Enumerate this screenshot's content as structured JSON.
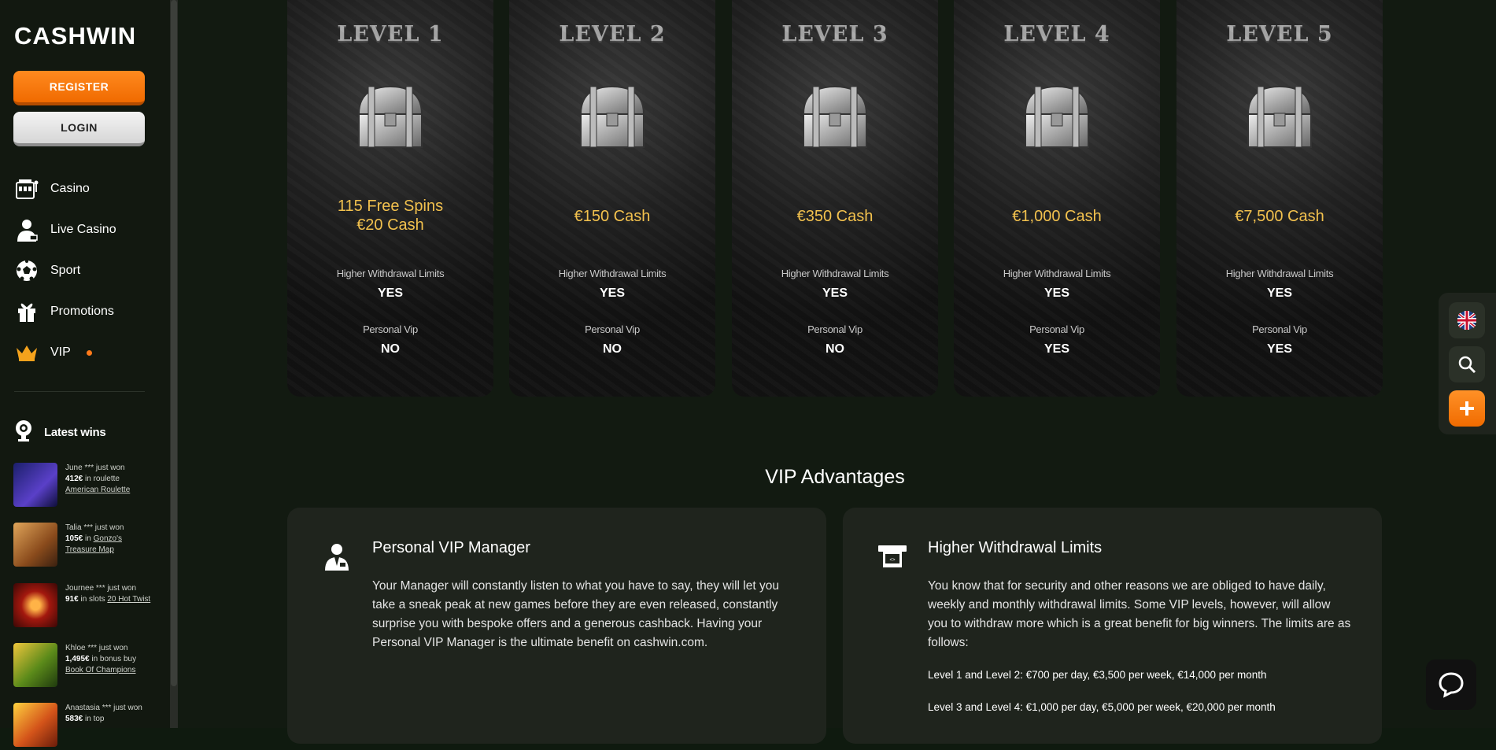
{
  "brand": {
    "logo": "CASHWIN"
  },
  "auth": {
    "register": "REGISTER",
    "login": "LOGIN"
  },
  "nav": [
    {
      "label": "Casino",
      "icon": "slot-machine-icon"
    },
    {
      "label": "Live Casino",
      "icon": "dealer-icon"
    },
    {
      "label": "Sport",
      "icon": "soccer-ball-icon"
    },
    {
      "label": "Promotions",
      "icon": "gift-icon"
    },
    {
      "label": "VIP",
      "icon": "crown-icon"
    }
  ],
  "latest_wins": {
    "title": "Latest wins",
    "items": [
      {
        "user": "June *** just won",
        "amount": "412€",
        "context": "in roulette",
        "game": "American Roulette",
        "thumb_color": "#3a2f8f"
      },
      {
        "user": "Talia *** just won",
        "amount": "105€",
        "context": "in",
        "game": "Gonzo's Treasure Map",
        "thumb_color": "#b3752a"
      },
      {
        "user": "Journee *** just won",
        "amount": "91€",
        "context": "in slots",
        "game": "20 Hot Twist",
        "thumb_color": "#6a1a10"
      },
      {
        "user": "Khloe *** just won",
        "amount": "1,495€",
        "context": "in bonus buy",
        "game": "Book Of Champions",
        "thumb_color": "#3b6d1f"
      },
      {
        "user": "Anastasia *** just won",
        "amount": "583€",
        "context": "in top",
        "game": "",
        "thumb_color": "#c24a18"
      }
    ]
  },
  "levels": [
    {
      "title": "LEVEL 1",
      "reward": "115 Free Spins\n€20 Cash",
      "withdrawal_label": "Higher Withdrawal Limits",
      "withdrawal": "YES",
      "vip_label": "Personal Vip",
      "vip": "NO"
    },
    {
      "title": "LEVEL 2",
      "reward": "€150 Cash",
      "withdrawal_label": "Higher Withdrawal Limits",
      "withdrawal": "YES",
      "vip_label": "Personal Vip",
      "vip": "NO"
    },
    {
      "title": "LEVEL 3",
      "reward": "€350 Cash",
      "withdrawal_label": "Higher Withdrawal Limits",
      "withdrawal": "YES",
      "vip_label": "Personal Vip",
      "vip": "NO"
    },
    {
      "title": "LEVEL 4",
      "reward": "€1,000 Cash",
      "withdrawal_label": "Higher Withdrawal Limits",
      "withdrawal": "YES",
      "vip_label": "Personal Vip",
      "vip": "YES"
    },
    {
      "title": "LEVEL 5",
      "reward": "€7,500 Cash",
      "withdrawal_label": "Higher Withdrawal Limits",
      "withdrawal": "YES",
      "vip_label": "Personal Vip",
      "vip": "YES"
    }
  ],
  "advantages": {
    "title": "VIP Advantages",
    "manager": {
      "title": "Personal VIP Manager",
      "body": "Your Manager will constantly listen to what you have to say, they will let you take a sneak peak at new games before they are even released, constantly surprise you with bespoke offers and a generous cashback. Having your Personal VIP Manager is the ultimate benefit on cashwin.com."
    },
    "withdrawal": {
      "title": "Higher Withdrawal Limits",
      "body": "You know that for security and other reasons we are obliged to have daily, weekly and monthly withdrawal limits. Some VIP levels, however, will allow you to withdraw more which is a great benefit for big winners. The limits are as follows:",
      "line1": "Level 1 and Level 2: €700 per day, €3,500 per week, €14,000 per month",
      "line2": "Level 3 and Level 4: €1,000 per day, €5,000 per week, €20,000 per month"
    }
  },
  "colors": {
    "accent": "#f06a00",
    "gold": "#f2c14e",
    "card": "#1f241d"
  }
}
